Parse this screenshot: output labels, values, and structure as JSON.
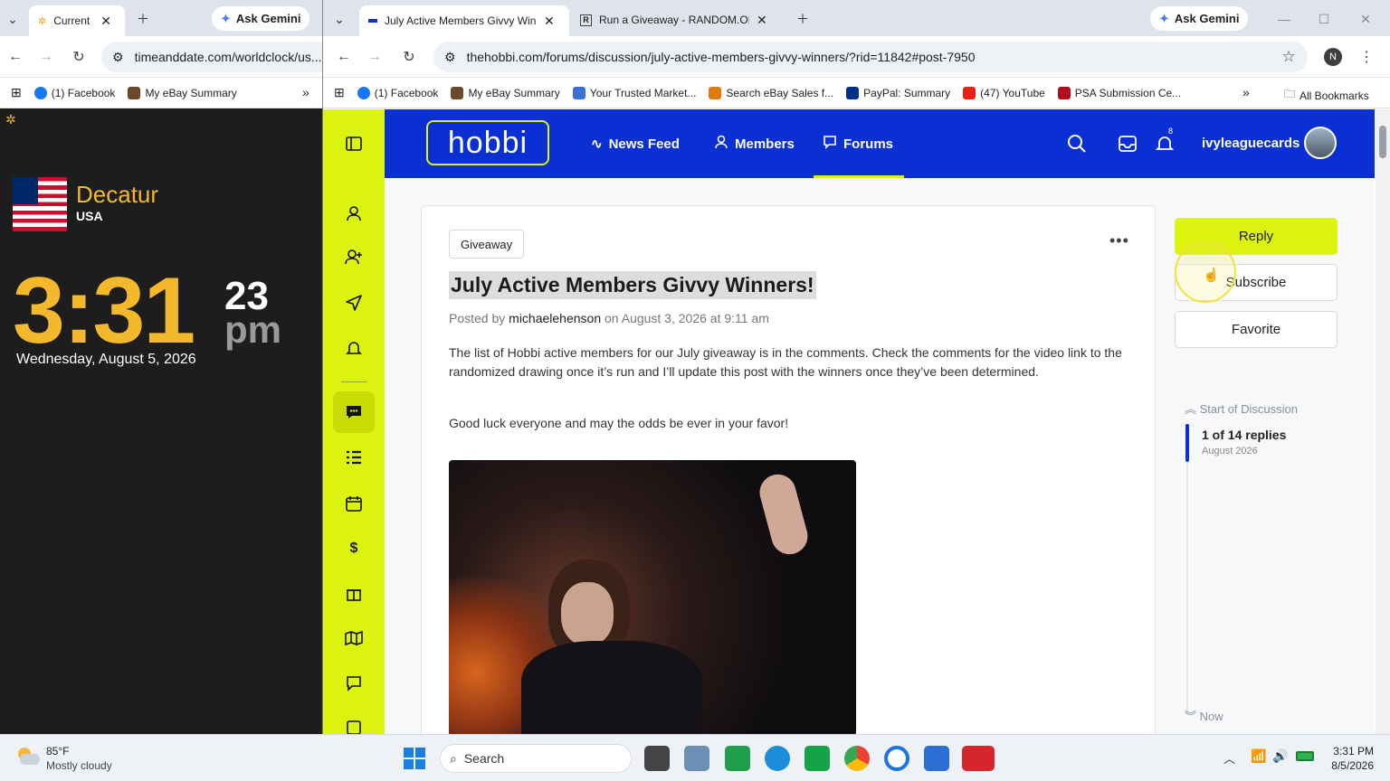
{
  "left_window": {
    "tab_title": "Current",
    "ask_gemini": "Ask Gemini",
    "url": "timeanddate.com/worldclock/us...",
    "bookmarks": [
      "(1) Facebook",
      "My eBay Summary"
    ],
    "clock": {
      "city": "Decatur",
      "country": "USA",
      "time": "3:31",
      "seconds": "23",
      "ampm": "pm",
      "date": "Wednesday, August 5, 2026"
    }
  },
  "right_window": {
    "tabs": [
      {
        "title": "July Active Members Givvy Win",
        "active": true
      },
      {
        "title": "Run a Giveaway - RANDOM.OR",
        "active": false
      }
    ],
    "ask_gemini": "Ask Gemini",
    "url": "thehobbi.com/forums/discussion/july-active-members-givvy-winners/?rid=11842#post-7950",
    "profile_initial": "N",
    "bookmarks": [
      "(1) Facebook",
      "My eBay Summary",
      "Your Trusted Market...",
      "Search eBay Sales f...",
      "PayPal: Summary",
      "(47) YouTube",
      "PSA Submission Ce..."
    ],
    "all_bookmarks": "All Bookmarks"
  },
  "hobbi": {
    "logo": "hobbi",
    "nav": [
      "News Feed",
      "Members",
      "Forums"
    ],
    "notification_count": "8",
    "username": "ivyleaguecards",
    "post": {
      "tag": "Giveaway",
      "title": "July Active Members Givvy Winners!",
      "posted_by_prefix": "Posted by",
      "author": "michaelehenson",
      "date_text": "on August 3, 2026 at 9:11 am",
      "body1": "The list of Hobbi active members for our July giveaway is in the comments. Check the comments for the video link to the randomized drawing once it’s run and I’ll update this post with the winners once they’ve been determined.",
      "body2": "Good luck everyone and may the odds be ever in your favor!"
    },
    "actions": {
      "reply": "Reply",
      "subscribe": "Subscribe",
      "favorite": "Favorite"
    },
    "timeline": {
      "start": "Start of Discussion",
      "count": "1 of 14 replies",
      "month": "August 2026",
      "end": "Now"
    },
    "colors": {
      "brand_blue": "#0a2fd3",
      "lime": "#dcf20f"
    }
  },
  "taskbar": {
    "weather_temp": "85°F",
    "weather_desc": "Mostly cloudy",
    "search": "Search",
    "time": "3:31 PM",
    "date": "8/5/2026"
  }
}
